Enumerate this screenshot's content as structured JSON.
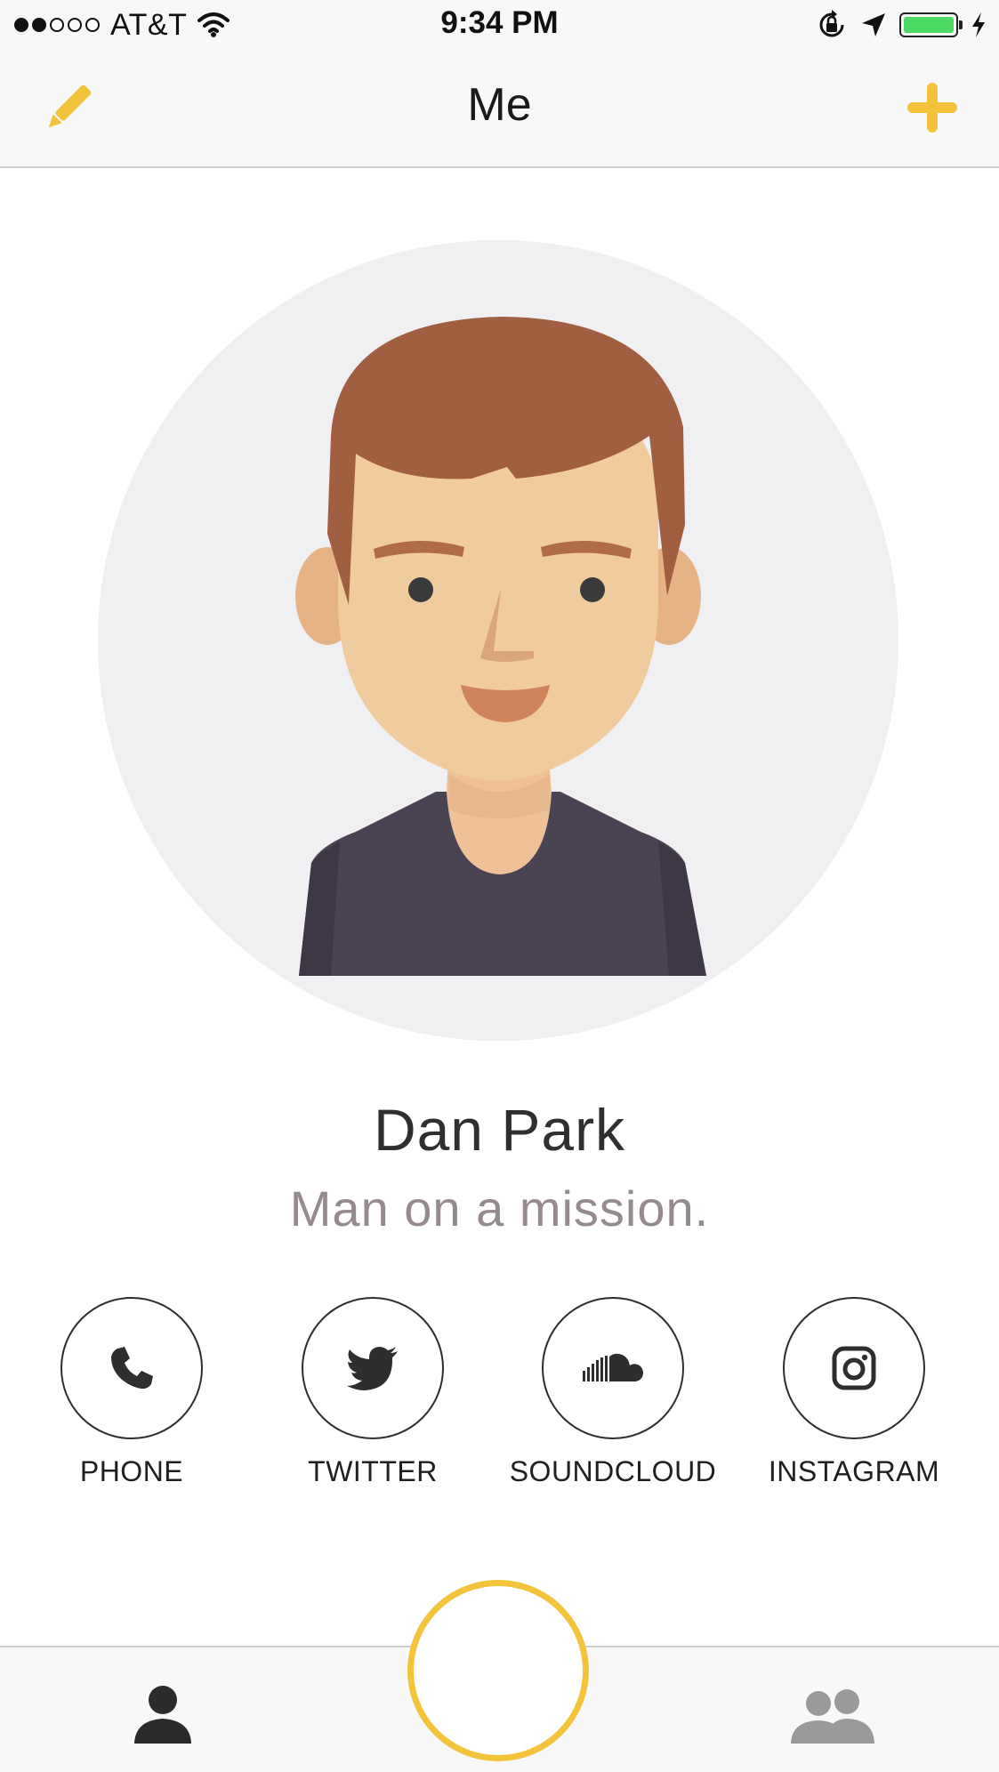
{
  "status_bar": {
    "carrier": "AT&T",
    "signal_bars_filled": 2,
    "signal_bars_total": 5,
    "time": "9:34 PM",
    "battery_level": 1.0,
    "battery_color": "#4cd964",
    "icons": [
      "wifi-icon",
      "rotation-lock-icon",
      "location-arrow-icon",
      "battery-icon",
      "charging-bolt-icon"
    ]
  },
  "nav": {
    "title": "Me",
    "left_icon": "pencil-icon",
    "right_icon": "plus-icon",
    "accent_color": "#f2c33b"
  },
  "profile": {
    "name": "Dan Park",
    "tagline": "Man on a mission.",
    "avatar": "cartoon-man-avatar"
  },
  "social_links": [
    {
      "label": "PHONE",
      "icon": "phone-icon"
    },
    {
      "label": "TWITTER",
      "icon": "twitter-icon"
    },
    {
      "label": "SOUNDCLOUD",
      "icon": "soundcloud-icon"
    },
    {
      "label": "INSTAGRAM",
      "icon": "instagram-icon"
    }
  ],
  "tab_bar": {
    "left_icon": "person-icon",
    "center": "capture-button",
    "right_icon": "friends-icon",
    "capture_ring_color": "#f2c33b"
  }
}
